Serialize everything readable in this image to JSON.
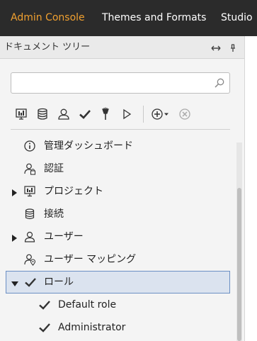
{
  "nav": {
    "tabs": [
      {
        "label": "Admin Console",
        "active": true
      },
      {
        "label": "Themes and Formats",
        "active": false
      },
      {
        "label": "Studio",
        "active": false
      }
    ],
    "active_color": "#f0a030"
  },
  "panel": {
    "title": "ドキュメント ツリー",
    "expand_icon": "double-arrow-icon",
    "pin_icon": "pin-icon"
  },
  "search": {
    "value": "",
    "placeholder": "",
    "icon": "search-icon"
  },
  "toolbar": {
    "buttons": [
      {
        "name": "project-icon"
      },
      {
        "name": "database-icon"
      },
      {
        "name": "user-icon"
      },
      {
        "name": "check-icon"
      },
      {
        "name": "torch-icon"
      },
      {
        "name": "play-icon"
      },
      {
        "name": "add-menu-icon"
      },
      {
        "name": "remove-icon"
      }
    ]
  },
  "tree": {
    "items": [
      {
        "label": "管理ダッシュボード",
        "icon": "info-icon",
        "expandable": false,
        "expanded": false,
        "level": 0,
        "selected": false
      },
      {
        "label": "認証",
        "icon": "user-lock-icon",
        "expandable": false,
        "expanded": false,
        "level": 0,
        "selected": false
      },
      {
        "label": "プロジェクト",
        "icon": "project-icon",
        "expandable": true,
        "expanded": false,
        "level": 0,
        "selected": false
      },
      {
        "label": "接続",
        "icon": "database-icon",
        "expandable": false,
        "expanded": false,
        "level": 0,
        "selected": false
      },
      {
        "label": "ユーザー",
        "icon": "user-icon",
        "expandable": true,
        "expanded": false,
        "level": 0,
        "selected": false
      },
      {
        "label": "ユーザー マッピング",
        "icon": "user-map-icon",
        "expandable": false,
        "expanded": false,
        "level": 0,
        "selected": false
      },
      {
        "label": "ロール",
        "icon": "check-icon",
        "expandable": true,
        "expanded": true,
        "level": 0,
        "selected": true
      },
      {
        "label": "Default role",
        "icon": "check-icon",
        "expandable": false,
        "expanded": false,
        "level": 1,
        "selected": false
      },
      {
        "label": "Administrator",
        "icon": "check-icon",
        "expandable": false,
        "expanded": false,
        "level": 1,
        "selected": false
      }
    ]
  }
}
